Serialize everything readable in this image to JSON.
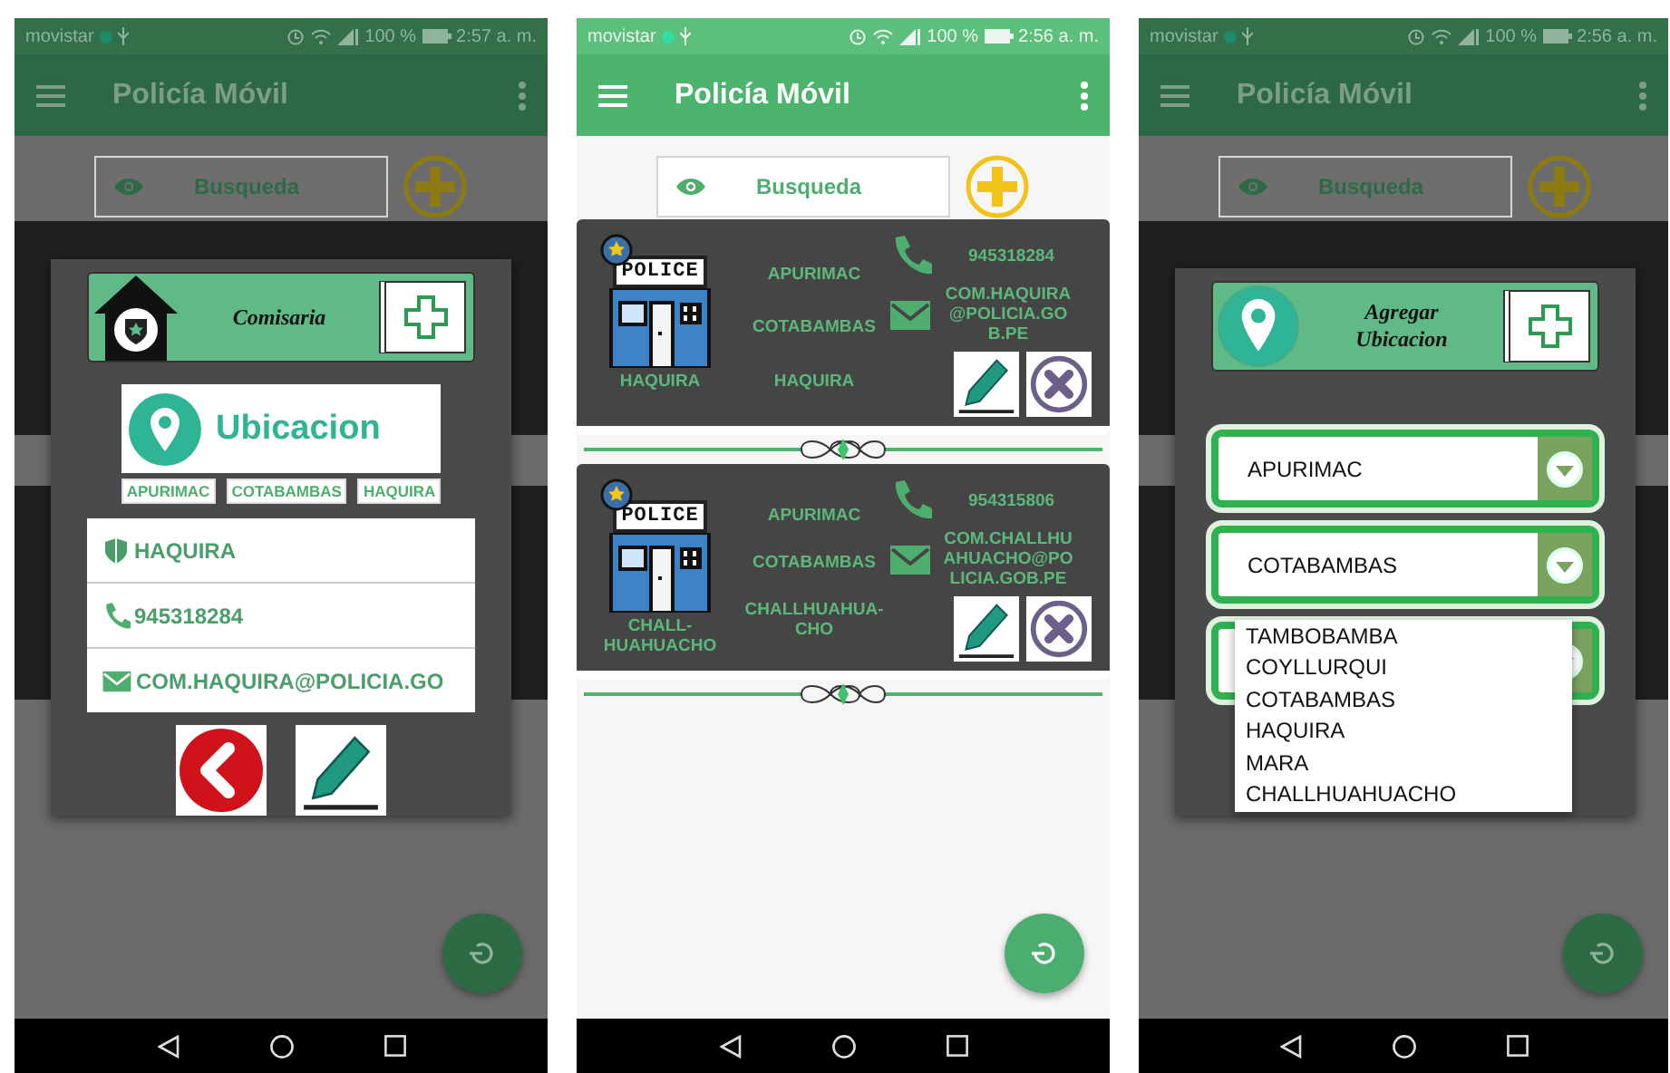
{
  "phones": [
    {
      "status_bar": {
        "carrier": "movistar",
        "battery": "100 %",
        "time": "2:57 a. m."
      },
      "app_bar": {
        "title": "Policía Móvil"
      },
      "search": {
        "label": "Busqueda"
      },
      "dialog": {
        "kind": "detail",
        "header": "Comisaria",
        "banner": "Ubicacion",
        "chips": [
          "APURIMAC",
          "COTABAMBAS",
          "HAQUIRA"
        ],
        "rows": [
          {
            "kind": "station",
            "text": "HAQUIRA"
          },
          {
            "kind": "phone",
            "text": "945318284"
          },
          {
            "kind": "email",
            "text": "COM.HAQUIRA@POLICIA.GO"
          }
        ]
      }
    },
    {
      "status_bar": {
        "carrier": "movistar",
        "battery": "100 %",
        "time": "2:56 a. m."
      },
      "app_bar": {
        "title": "Policía Móvil"
      },
      "search": {
        "label": "Busqueda"
      },
      "cards": [
        {
          "sign": "POLICE",
          "name": "HAQUIRA",
          "region": "APURIMAC",
          "province": "COTABAMBAS",
          "district": "HAQUIRA",
          "phone": "945318284",
          "email": "COM.HAQUIRA@POLICIA.GOB.PE"
        },
        {
          "sign": "POLICE",
          "name": "CHALL-HUAHUACHO",
          "region": "APURIMAC",
          "province": "COTABAMBAS",
          "district": "CHALLHUAHUA-CHO",
          "phone": "954315806",
          "email": "COM.CHALLHUAHUACHO@POLICIA.GOB.PE"
        }
      ]
    },
    {
      "status_bar": {
        "carrier": "movistar",
        "battery": "100 %",
        "time": "2:56 a. m."
      },
      "app_bar": {
        "title": "Policía Móvil"
      },
      "search": {
        "label": "Busqueda"
      },
      "dialog": {
        "kind": "add_location",
        "header": "Agregar Ubicacion",
        "selects": [
          "APURIMAC",
          "COTABAMBAS"
        ],
        "dropdown_options": [
          "TAMBOBAMBA",
          "COYLLURQUI",
          "COTABAMBAS",
          "HAQUIRA",
          "MARA",
          "CHALLHUAHUACHO"
        ]
      }
    }
  ]
}
